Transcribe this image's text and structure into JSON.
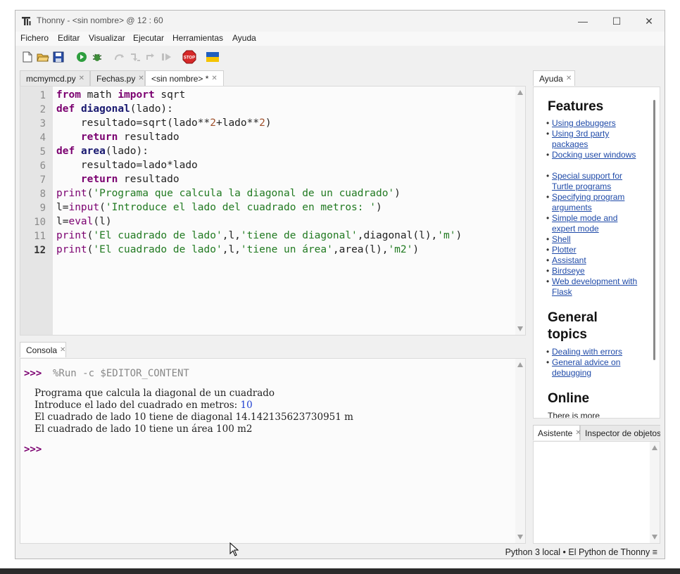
{
  "window": {
    "title": "Thonny  -  <sin nombre>  @  12 : 60",
    "controls": {
      "minimize": "—",
      "maximize": "☐",
      "close": "✕"
    }
  },
  "menu": [
    "Fichero",
    "Editar",
    "Visualizar",
    "Ejecutar",
    "Herramientas",
    "Ayuda"
  ],
  "toolbar": {
    "icons": [
      "new-file-icon",
      "open-file-icon",
      "save-icon",
      "run-icon",
      "debug-icon",
      "step-over-icon",
      "step-into-icon",
      "step-out-icon",
      "resume-icon",
      "stop-icon",
      "ukraine-flag-icon"
    ],
    "stop_label": "STOP"
  },
  "editor_tabs": [
    {
      "label": "mcmymcd.py",
      "active": false
    },
    {
      "label": "Fechas.py",
      "active": false
    },
    {
      "label": "<sin nombre> *",
      "active": true
    }
  ],
  "editor": {
    "line_numbers": [
      "1",
      "2",
      "3",
      "4",
      "5",
      "6",
      "7",
      "8",
      "9",
      "10",
      "11",
      "12"
    ],
    "current_line": 12,
    "code": [
      "from math import sqrt",
      "def diagonal(lado):",
      "    resultado=sqrt(lado**2+lado**2)",
      "    return resultado",
      "def area(lado):",
      "    resultado=lado*lado",
      "    return resultado",
      "print('Programa que calcula la diagonal de un cuadrado')",
      "l=input('Introduce el lado del cuadrado en metros: ')",
      "l=eval(l)",
      "print('El cuadrado de lado',l,'tiene de diagonal',diagonal(l),'m')",
      "print('El cuadrado de lado',l,'tiene un área',area(l),'m2')"
    ]
  },
  "console_tab": {
    "label": "Consola"
  },
  "console": {
    "prompt": ">>>",
    "command": "%Run -c $EDITOR_CONTENT",
    "output": [
      "Programa que calcula la diagonal de un cuadrado",
      "Introduce el lado del cuadrado en metros: ",
      "El cuadrado de lado 10 tiene de diagonal 14.142135623730951 m",
      "El cuadrado de lado 10 tiene un área 100 m2"
    ],
    "user_input": "10",
    "final_prompt": ">>>"
  },
  "help_tab": {
    "label": "Ayuda"
  },
  "help": {
    "sections": [
      {
        "heading": "Features",
        "links": [
          "Using debuggers",
          "Using 3rd party packages",
          "Docking user windows",
          "Special support for Turtle programs",
          "Specifying program arguments",
          "Simple mode and expert mode",
          "Shell",
          "Plotter",
          "Assistant",
          "Birdseye",
          "Web development with Flask"
        ]
      },
      {
        "heading": "General topics",
        "links": [
          "Dealing with errors",
          "General advice on debugging"
        ]
      },
      {
        "heading": "Online",
        "links": []
      }
    ],
    "trailing_text": "There is more"
  },
  "assistant_tabs": [
    {
      "label": "Asistente"
    },
    {
      "label": "Inspector de objetos"
    }
  ],
  "status": {
    "interpreter": "Python 3 local  •  El Python de Thonny  ≡"
  }
}
